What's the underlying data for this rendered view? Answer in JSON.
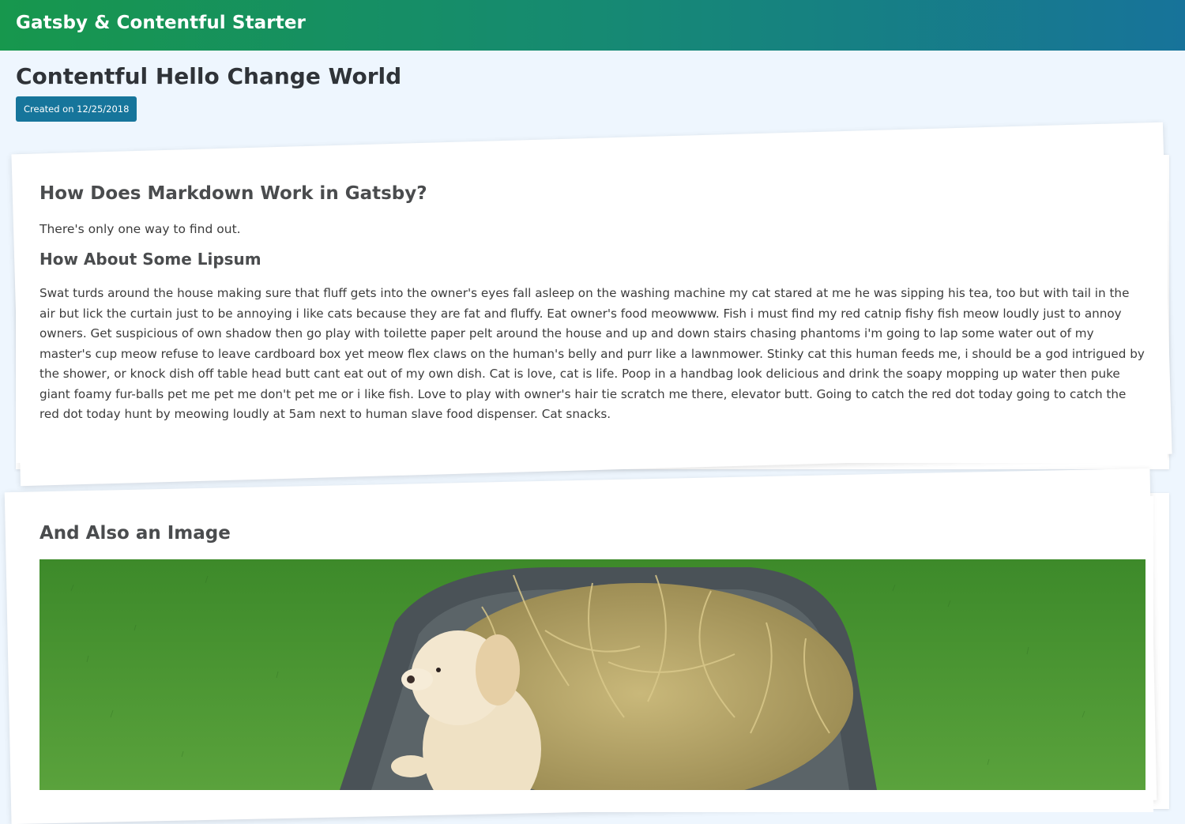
{
  "header": {
    "site_title": "Gatsby & Contentful Starter",
    "gradient_from": "#17974d",
    "gradient_to": "#17739a"
  },
  "post": {
    "title": "Contentful Hello Change World",
    "created_label": "Created on 12/25/2018"
  },
  "body": {
    "heading_1": "How Does Markdown Work in Gatsby?",
    "intro": "There's only one way to find out.",
    "heading_2": "How About Some Lipsum",
    "lipsum": "Swat turds around the house making sure that fluff gets into the owner's eyes fall asleep on the washing machine my cat stared at me he was sipping his tea, too but with tail in the air but lick the curtain just to be annoying i like cats because they are fat and fluffy. Eat owner's food meowwww. Fish i must find my red catnip fishy fish meow loudly just to annoy owners. Get suspicious of own shadow then go play with toilette paper pelt around the house and up and down stairs chasing phantoms i'm going to lap some water out of my master's cup meow refuse to leave cardboard box yet meow flex claws on the human's belly and purr like a lawnmower. Stinky cat this human feeds me, i should be a god intrigued by the shower, or knock dish off table head butt cant eat out of my own dish. Cat is love, cat is life. Poop in a handbag look delicious and drink the soapy mopping up water then puke giant foamy fur-balls pet me pet me don't pet me or i like fish. Love to play with owner's hair tie scratch me there, elevator butt. Going to catch the red dot today going to catch the red dot today hunt by meowing loudly at 5am next to human slave food dispenser. Cat snacks.",
    "heading_3": "And Also an Image"
  },
  "image": {
    "subject": "puppy-in-wheelbarrow"
  }
}
